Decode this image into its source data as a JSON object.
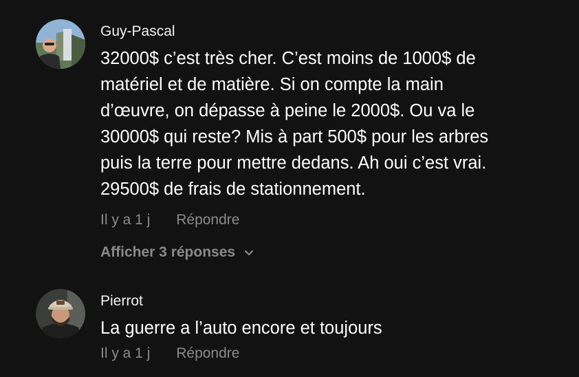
{
  "comments": [
    {
      "author": "Guy-Pascal",
      "lines": [
        "32000$ c’est très cher. C’est moins de 1000$ de",
        "matériel et de matière. Si on compte la main",
        "d’œuvre, on dépasse à peine le 2000$. Ou va le",
        "30000$ qui reste? Mis à part 500$ pour les arbres",
        "puis la terre pour mettre dedans. Ah oui c’est vrai.",
        "29500$ de frais de stationnement."
      ],
      "time": "Il y a 1 j",
      "reply_label": "Répondre",
      "show_replies_label": "Afficher 3 réponses"
    },
    {
      "author": "Pierrot",
      "lines": [
        "La guerre a l’auto encore et toujours"
      ],
      "time": "Il y a 1 j",
      "reply_label": "Répondre"
    }
  ],
  "colors": {
    "background": "#121212",
    "text": "#ffffff",
    "muted": "#8a8a8a"
  }
}
